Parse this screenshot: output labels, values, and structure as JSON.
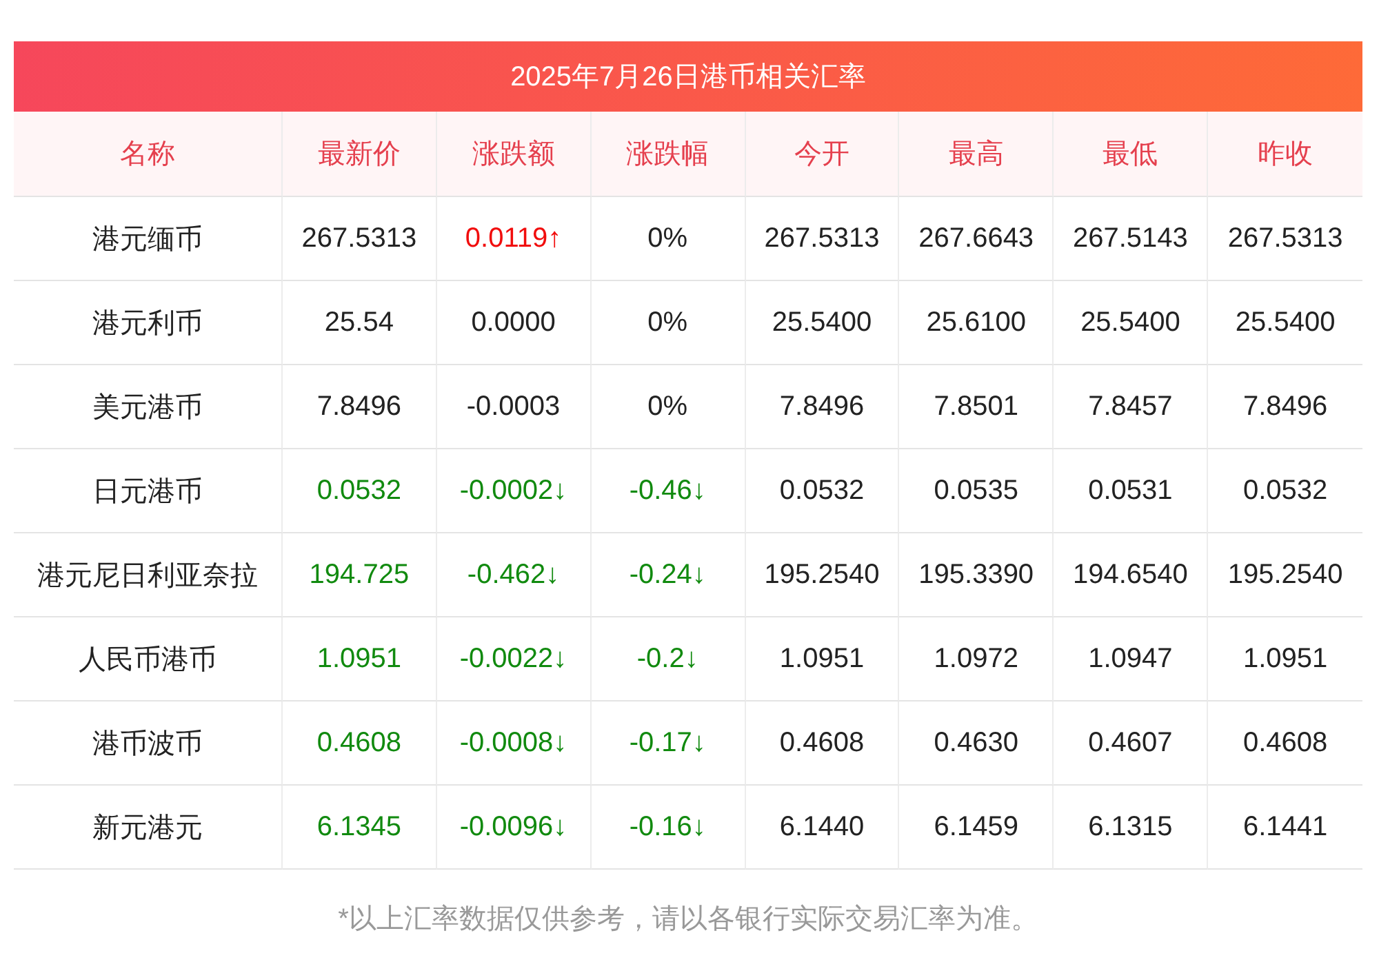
{
  "title": "2025年7月26日港币相关汇率",
  "columns": [
    "名称",
    "最新价",
    "涨跌额",
    "涨跌幅",
    "今开",
    "最高",
    "最低",
    "昨收"
  ],
  "rows": [
    {
      "name": "港元缅币",
      "latest": {
        "text": "267.5313",
        "color": "#222222"
      },
      "change": {
        "text": "0.0119↑",
        "color": "#f10d0d"
      },
      "pct": {
        "text": "0%",
        "color": "#222222"
      },
      "open": "267.5313",
      "high": "267.6643",
      "low": "267.5143",
      "prev": "267.5313"
    },
    {
      "name": "港元利币",
      "latest": {
        "text": "25.54",
        "color": "#222222"
      },
      "change": {
        "text": "0.0000",
        "color": "#222222"
      },
      "pct": {
        "text": "0%",
        "color": "#222222"
      },
      "open": "25.5400",
      "high": "25.6100",
      "low": "25.5400",
      "prev": "25.5400"
    },
    {
      "name": "美元港币",
      "latest": {
        "text": "7.8496",
        "color": "#222222"
      },
      "change": {
        "text": "-0.0003",
        "color": "#222222"
      },
      "pct": {
        "text": "0%",
        "color": "#222222"
      },
      "open": "7.8496",
      "high": "7.8501",
      "low": "7.8457",
      "prev": "7.8496"
    },
    {
      "name": "日元港币",
      "latest": {
        "text": "0.0532",
        "color": "#118a0f"
      },
      "change": {
        "text": "-0.0002↓",
        "color": "#118a0f"
      },
      "pct": {
        "text": "-0.46↓",
        "color": "#118a0f"
      },
      "open": "0.0532",
      "high": "0.0535",
      "low": "0.0531",
      "prev": "0.0532"
    },
    {
      "name": "港元尼日利亚奈拉",
      "latest": {
        "text": "194.725",
        "color": "#118a0f"
      },
      "change": {
        "text": "-0.462↓",
        "color": "#118a0f"
      },
      "pct": {
        "text": "-0.24↓",
        "color": "#118a0f"
      },
      "open": "195.2540",
      "high": "195.3390",
      "low": "194.6540",
      "prev": "195.2540"
    },
    {
      "name": "人民币港币",
      "latest": {
        "text": "1.0951",
        "color": "#118a0f"
      },
      "change": {
        "text": "-0.0022↓",
        "color": "#118a0f"
      },
      "pct": {
        "text": "-0.2↓",
        "color": "#118a0f"
      },
      "open": "1.0951",
      "high": "1.0972",
      "low": "1.0947",
      "prev": "1.0951"
    },
    {
      "name": "港币波币",
      "latest": {
        "text": "0.4608",
        "color": "#118a0f"
      },
      "change": {
        "text": "-0.0008↓",
        "color": "#118a0f"
      },
      "pct": {
        "text": "-0.17↓",
        "color": "#118a0f"
      },
      "open": "0.4608",
      "high": "0.4630",
      "low": "0.4607",
      "prev": "0.4608"
    },
    {
      "name": "新元港元",
      "latest": {
        "text": "6.1345",
        "color": "#118a0f"
      },
      "change": {
        "text": "-0.0096↓",
        "color": "#118a0f"
      },
      "pct": {
        "text": "-0.16↓",
        "color": "#118a0f"
      },
      "open": "6.1440",
      "high": "6.1459",
      "low": "6.1315",
      "prev": "6.1441"
    }
  ],
  "footnote": "*以上汇率数据仅供参考，请以各银行实际交易汇率为准。"
}
